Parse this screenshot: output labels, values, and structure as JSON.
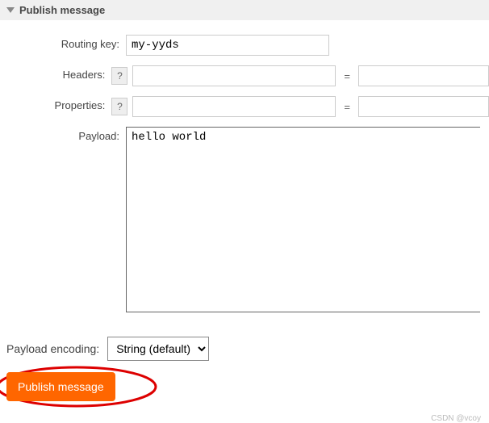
{
  "section": {
    "title": "Publish message"
  },
  "form": {
    "routing_key_label": "Routing key:",
    "routing_key_value": "my-yyds",
    "headers_label": "Headers:",
    "headers_key": "",
    "headers_value": "",
    "properties_label": "Properties:",
    "properties_key": "",
    "properties_value": "",
    "payload_label": "Payload:",
    "payload_value": "hello world",
    "help_symbol": "?",
    "equals": "="
  },
  "encoding": {
    "label": "Payload encoding:",
    "selected": "String (default)"
  },
  "actions": {
    "publish_label": "Publish message"
  },
  "watermark": "CSDN @vcoy"
}
